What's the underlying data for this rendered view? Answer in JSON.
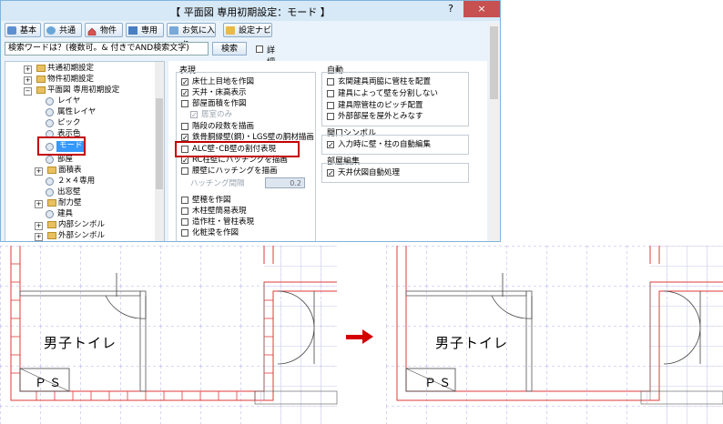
{
  "window": {
    "title": "【 平面図 専用初期設定：モード 】",
    "help": "?",
    "close": "×"
  },
  "toolbar": {
    "buttons": [
      {
        "label": "基本"
      },
      {
        "label": "共通"
      },
      {
        "label": "物件"
      },
      {
        "label": "専用"
      },
      {
        "label": "お気に入り",
        "dropdown": "▼"
      },
      {
        "label": "設定ナビ"
      }
    ]
  },
  "search": {
    "value": "検索ワードは？(複数可。& 付きでAND検索文字)",
    "button": "検索",
    "detail_label": "詳細検索"
  },
  "tree": {
    "items": [
      {
        "label": "共通初期設定",
        "exp": "+"
      },
      {
        "label": "物件初期設定",
        "exp": "+"
      },
      {
        "label": "平面図 専用初期設定",
        "exp": "−"
      },
      {
        "label": "レイヤ"
      },
      {
        "label": "属性レイヤ"
      },
      {
        "label": "ピック"
      },
      {
        "label": "表示色"
      },
      {
        "label": "モード"
      },
      {
        "label": "部屋"
      },
      {
        "label": "面積表",
        "exp": "+"
      },
      {
        "label": "２×４専用"
      },
      {
        "label": "出窓壁"
      },
      {
        "label": "耐力壁",
        "exp": "+"
      },
      {
        "label": "建具"
      },
      {
        "label": "内部シンボル",
        "exp": "+"
      },
      {
        "label": "外部シンボル",
        "exp": "+"
      }
    ]
  },
  "panel": {
    "display": {
      "title": "表現",
      "options": [
        {
          "label": "床仕上目地を作図",
          "checked": true
        },
        {
          "label": "天井・床高表示",
          "checked": true
        },
        {
          "label": "部屋面積を作図",
          "checked": false
        },
        {
          "label": "居室のみ",
          "checked": true,
          "disabled": true
        },
        {
          "label": "階段の段数を描画",
          "checked": false
        },
        {
          "label": "鉄骨胴縁壁(鋼)・LGS壁の胴材描画",
          "checked": true
        },
        {
          "label": "ALC壁･CB壁の割付表現",
          "checked": false
        },
        {
          "label": "RC柱壁にハッチングを描画",
          "checked": true
        },
        {
          "label": "腰壁にハッチングを描画",
          "checked": false
        },
        {
          "label": "壁穂を作図",
          "checked": false
        },
        {
          "label": "木柱壁簡易表現",
          "checked": false
        },
        {
          "label": "造作柱・管柱表現",
          "checked": false
        },
        {
          "label": "化粧梁を作図",
          "checked": false
        }
      ],
      "hatch_label": "ハッチング間隔",
      "hatch_value": "0.2"
    },
    "auto": {
      "title": "自動",
      "options": [
        {
          "label": "玄関建具両脇に管柱を配置",
          "checked": false
        },
        {
          "label": "建具によって壁を分割しない",
          "checked": false
        },
        {
          "label": "建具際管柱のピッチ配置",
          "checked": false
        },
        {
          "label": "外部部屋を屋外とみなす",
          "checked": false
        }
      ]
    },
    "opening": {
      "title": "開口シンボル",
      "options": [
        {
          "label": "入力時に壁・柱の自動編集",
          "checked": true
        }
      ]
    },
    "room_edit": {
      "title": "部屋編集",
      "options": [
        {
          "label": "天井伏図自動処理",
          "checked": true
        }
      ]
    }
  },
  "drawing": {
    "room_label": "男子トイレ",
    "ps_label": "ＰＳ"
  },
  "colors": {
    "highlight": "#c40000",
    "wall_red": "#e23a3a",
    "grid_blue": "#8a8ae8",
    "arrow": "#d40000"
  }
}
